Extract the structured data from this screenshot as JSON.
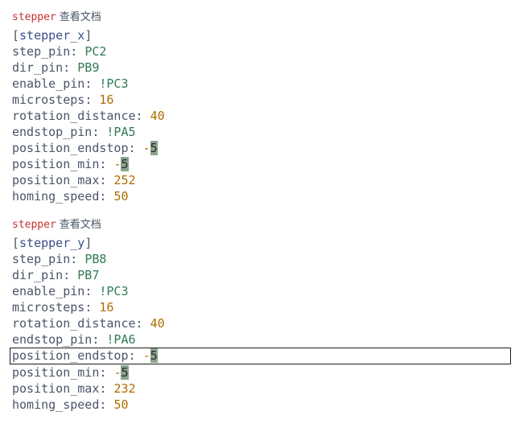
{
  "header": {
    "tag": "stepper",
    "doc_link_label": "查看文档"
  },
  "blocks": [
    {
      "section": "stepper_x",
      "lines": [
        {
          "key": "step_pin",
          "sep": ": ",
          "val": "PC2",
          "vclass": "pin"
        },
        {
          "key": "dir_pin",
          "sep": ": ",
          "val": "PB9",
          "vclass": "pin"
        },
        {
          "key": "enable_pin",
          "sep": ": ",
          "val": "!PC3",
          "vclass": "pin"
        },
        {
          "key": "microsteps",
          "sep": ": ",
          "val": "16",
          "vclass": "num"
        },
        {
          "key": "rotation_distance",
          "sep": ": ",
          "val": "40",
          "vclass": "num"
        },
        {
          "key": "endstop_pin",
          "sep": ": ",
          "val": "!PA5",
          "vclass": "pin"
        },
        {
          "key": "position_endstop",
          "sep": ": ",
          "val": "-",
          "vclass": "num",
          "hl": "5"
        },
        {
          "key": "position_min",
          "sep": ": ",
          "val": "-",
          "vclass": "num",
          "hl": "5"
        },
        {
          "key": "position_max",
          "sep": ": ",
          "val": "252",
          "vclass": "num"
        },
        {
          "key": "homing_speed",
          "sep": ": ",
          "val": "50",
          "vclass": "num"
        }
      ]
    },
    {
      "section": "stepper_y",
      "lines": [
        {
          "key": "step_pin",
          "sep": ": ",
          "val": "PB8",
          "vclass": "pin"
        },
        {
          "key": "dir_pin",
          "sep": ": ",
          "val": "PB7",
          "vclass": "pin"
        },
        {
          "key": "enable_pin",
          "sep": ": ",
          "val": "!PC3",
          "vclass": "pin"
        },
        {
          "key": "microsteps",
          "sep": ": ",
          "val": "16",
          "vclass": "num"
        },
        {
          "key": "rotation_distance",
          "sep": ": ",
          "val": "40",
          "vclass": "num"
        },
        {
          "key": "endstop_pin",
          "sep": ": ",
          "val": "!PA6",
          "vclass": "pin"
        },
        {
          "key": "position_endstop",
          "sep": ": ",
          "val": "-",
          "vclass": "num",
          "hl": "5",
          "current": true
        },
        {
          "key": "position_min",
          "sep": ": ",
          "val": "-",
          "vclass": "num",
          "hl": "5"
        },
        {
          "key": "position_max",
          "sep": ": ",
          "val": "232",
          "vclass": "num"
        },
        {
          "key": "homing_speed",
          "sep": ": ",
          "val": "50",
          "vclass": "num"
        }
      ]
    }
  ]
}
